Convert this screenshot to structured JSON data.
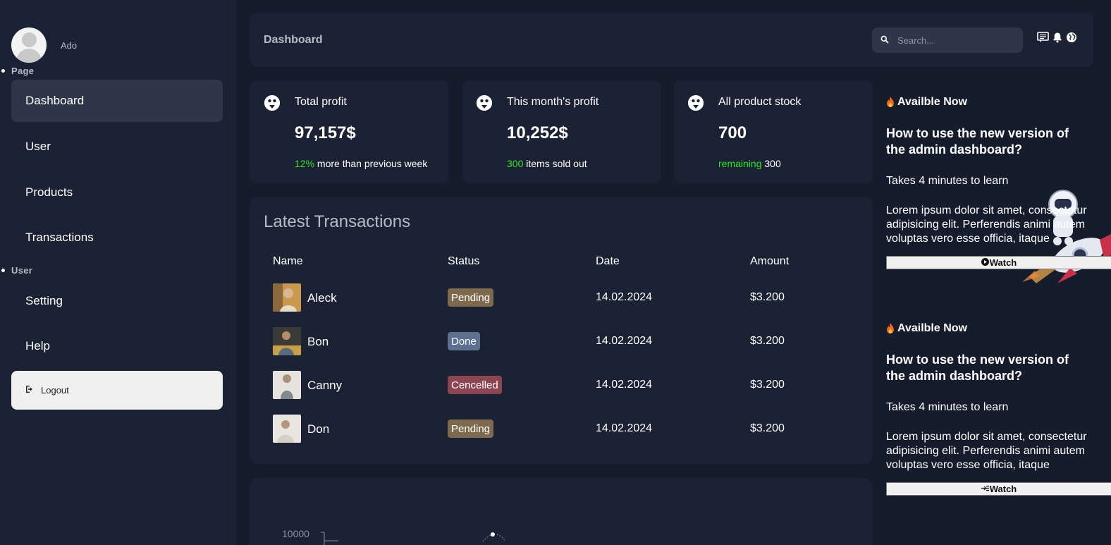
{
  "sidebar": {
    "username": "Ado",
    "sections": [
      {
        "title": "Page",
        "items": [
          {
            "label": "Dashboard",
            "active": true
          },
          {
            "label": "User"
          },
          {
            "label": "Products"
          },
          {
            "label": "Transactions"
          }
        ]
      },
      {
        "title": "User",
        "items": [
          {
            "label": "Setting"
          },
          {
            "label": "Help"
          }
        ]
      }
    ],
    "logout_label": "Logout",
    "logout_icon": "logout-icon"
  },
  "topbar": {
    "title": "Dashboard",
    "search_placeholder": "Search...",
    "icons": [
      "chat-icon",
      "bell-icon",
      "globe-icon"
    ]
  },
  "cards": [
    {
      "title": "Total profit",
      "value": "97,157$",
      "highlight": "12%",
      "detail": " more than previous week"
    },
    {
      "title": "This month's profit",
      "value": "10,252$",
      "highlight": "300",
      "detail": " items sold out"
    },
    {
      "title": "All product stock",
      "value": "700",
      "highlight": "remaining",
      "detail": " 300"
    }
  ],
  "transactions": {
    "title": "Latest Transactions",
    "columns": [
      "Name",
      "Status",
      "Date",
      "Amount"
    ],
    "rows": [
      {
        "name": "Aleck",
        "status": "Pending",
        "date": "14.02.2024",
        "amount": "$3.200"
      },
      {
        "name": "Bon",
        "status": "Done",
        "date": "14.02.2024",
        "amount": "$3.200"
      },
      {
        "name": "Canny",
        "status": "Cencelled",
        "date": "14.02.2024",
        "amount": "$3.200"
      },
      {
        "name": "Don",
        "status": "Pending",
        "date": "14.02.2024",
        "amount": "$3.200"
      }
    ],
    "status_colors": {
      "Pending": "#7d6a4d",
      "Done": "#5c7091",
      "Cencelled": "#8d4552"
    }
  },
  "chart": {
    "y_tick_label": "10000"
  },
  "promos": [
    {
      "badge": "Availble Now",
      "headline": "How to use the new version of the admin dashboard?",
      "sub": "Takes 4 minutes to learn",
      "desc": "Lorem ipsum dolor sit amet, consectetur adipisicing elit. Perferendis animi autem voluptas vero esse officia, itaque",
      "button": "Watch",
      "button_icon": "play-icon"
    },
    {
      "badge": "Availble Now",
      "headline": "How to use the new version of the admin dashboard?",
      "sub": "Takes 4 minutes to learn",
      "desc": "Lorem ipsum dolor sit amet, consectetur adipisicing elit. Perferendis animi autem voluptas vero esse officia, itaque",
      "button": "Watch",
      "button_icon": "arrow-right-icon"
    }
  ],
  "colors": {
    "background": "#151c2c",
    "panel": "#1a2234",
    "accent_green": "#2ae62a"
  }
}
